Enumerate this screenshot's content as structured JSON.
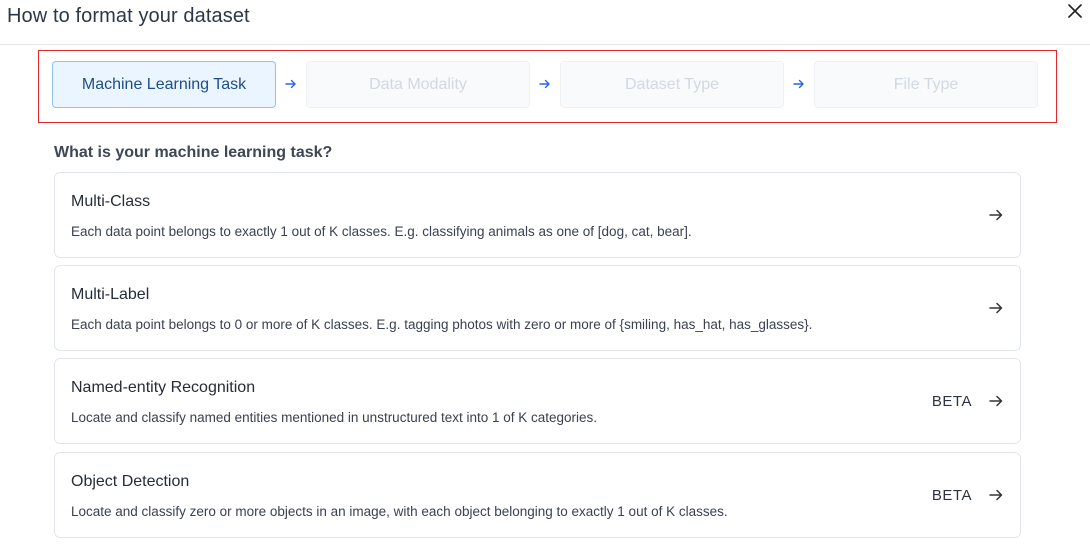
{
  "dialog": {
    "title": "How to format your dataset"
  },
  "steps": [
    {
      "label": "Machine Learning Task",
      "state": "active"
    },
    {
      "label": "Data Modality",
      "state": "inactive"
    },
    {
      "label": "Dataset Type",
      "state": "inactive"
    },
    {
      "label": "File Type",
      "state": "inactive"
    }
  ],
  "question": "What is your machine learning task?",
  "tasks": [
    {
      "title": "Multi-Class",
      "description": "Each data point belongs to exactly 1 out of K classes. E.g. classifying animals as one of [dog, cat, bear].",
      "badge": ""
    },
    {
      "title": "Multi-Label",
      "description": "Each data point belongs to 0 or more of K classes. E.g. tagging photos with zero or more of {smiling, has_hat, has_glasses}.",
      "badge": ""
    },
    {
      "title": "Named-entity Recognition",
      "description": "Locate and classify named entities mentioned in unstructured text into 1 of K categories.",
      "badge": "BETA"
    },
    {
      "title": "Object Detection",
      "description": "Locate and classify zero or more objects in an image, with each object belonging to exactly 1 out of K classes.",
      "badge": "BETA"
    }
  ],
  "colors": {
    "accent": "#1d4e89",
    "active_step_bg": "#ebf5ff",
    "highlight_border": "#e0282e",
    "step_arrow": "#2563eb"
  },
  "icons": {
    "close": "close-icon",
    "step_arrow": "arrow-right-icon",
    "card_arrow": "arrow-right-icon"
  }
}
